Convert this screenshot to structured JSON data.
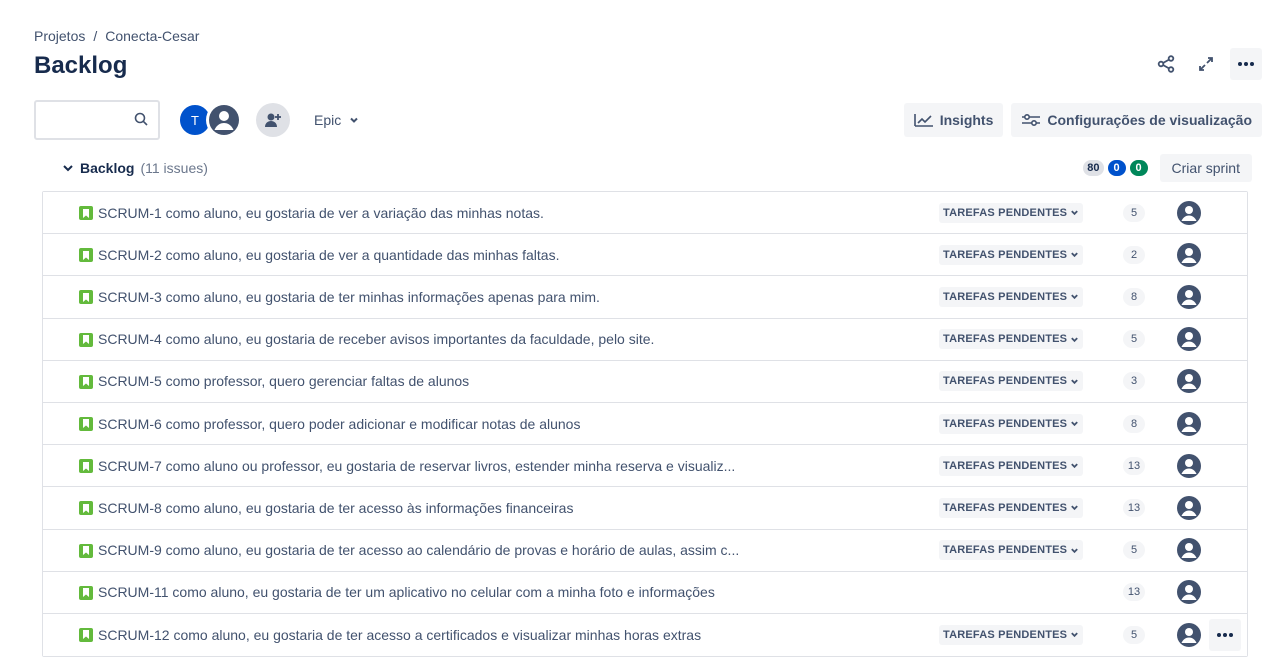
{
  "breadcrumb": {
    "projects": "Projetos",
    "separator": "/",
    "project": "Conecta-Cesar"
  },
  "page": {
    "title": "Backlog"
  },
  "toolbar": {
    "search_value": "",
    "avatar_initial": "T",
    "epic_label": "Epic",
    "insights_label": "Insights",
    "view_settings_label": "Configurações de visualização"
  },
  "backlog": {
    "title": "Backlog",
    "count_label": "(11 issues)",
    "points_todo": "80",
    "points_in_progress": "0",
    "points_done": "0",
    "create_sprint_label": "Criar sprint"
  },
  "issues": [
    {
      "key": "SCRUM-1",
      "summary": "como aluno, eu gostaria de ver a variação das minhas notas.",
      "status": "TAREFAS PENDENTES",
      "points": "5"
    },
    {
      "key": "SCRUM-2",
      "summary": "como aluno, eu gostaria de ver a quantidade das minhas faltas.",
      "status": "TAREFAS PENDENTES",
      "points": "2"
    },
    {
      "key": "SCRUM-3",
      "summary": "como aluno, eu gostaria de ter minhas informações apenas para mim.",
      "status": "TAREFAS PENDENTES",
      "points": "8"
    },
    {
      "key": "SCRUM-4",
      "summary": "como aluno, eu gostaria de receber avisos importantes da faculdade, pelo site.",
      "status": "TAREFAS PENDENTES",
      "points": "5"
    },
    {
      "key": "SCRUM-5",
      "summary": "como professor, quero gerenciar faltas de alunos",
      "status": "TAREFAS PENDENTES",
      "points": "3"
    },
    {
      "key": "SCRUM-6",
      "summary": "como professor, quero poder adicionar e modificar notas de alunos",
      "status": "TAREFAS PENDENTES",
      "points": "8"
    },
    {
      "key": "SCRUM-7",
      "summary": "como aluno ou professor, eu gostaria de reservar livros, estender minha reserva e visualiz...",
      "status": "TAREFAS PENDENTES",
      "points": "13"
    },
    {
      "key": "SCRUM-8",
      "summary": "como aluno, eu gostaria de ter acesso às informações financeiras",
      "status": "TAREFAS PENDENTES",
      "points": "13"
    },
    {
      "key": "SCRUM-9",
      "summary": "como aluno, eu gostaria de ter acesso ao calendário de provas e horário de aulas, assim c...",
      "status": "TAREFAS PENDENTES",
      "points": "5"
    },
    {
      "key": "SCRUM-11",
      "summary": "como aluno, eu gostaria de ter um aplicativo no celular com a minha foto e informações",
      "status": "",
      "points": "13"
    },
    {
      "key": "SCRUM-12",
      "summary": "como aluno, eu gostaria de ter acesso a certificados e visualizar minhas horas extras",
      "status": "TAREFAS PENDENTES",
      "points": "5"
    }
  ],
  "colors": {
    "brand_blue": "#0052cc",
    "story_green": "#63ba3c",
    "done_green": "#00875a",
    "text": "#172b4d",
    "muted": "#42526e"
  }
}
